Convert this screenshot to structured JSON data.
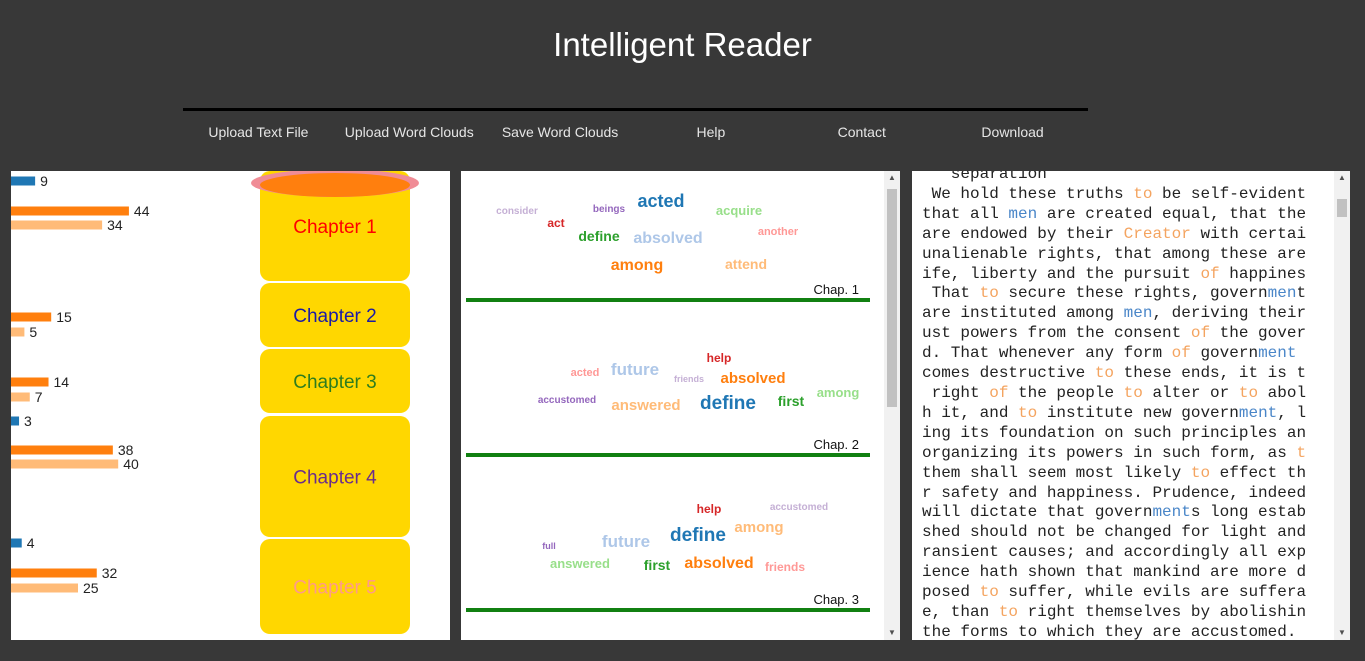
{
  "app": {
    "title": "Intelligent Reader"
  },
  "nav": [
    "Upload Text File",
    "Upload Word Clouds",
    "Save Word Clouds",
    "Help",
    "Contact",
    "Download"
  ],
  "colors": {
    "blue": "#1f77b4",
    "orange": "#ff7f0e",
    "light_orange": "#ffbb78",
    "chapter_fill": "#ffd700",
    "highlight": "#f08c96"
  },
  "chapters": [
    {
      "label": "Chapter 1",
      "color": "#ff0000"
    },
    {
      "label": "Chapter 2",
      "color": "#1a1aa6"
    },
    {
      "label": "Chapter 3",
      "color": "#2e7d1e"
    },
    {
      "label": "Chapter 4",
      "color": "#6a2c8c"
    },
    {
      "label": "Chapter 5",
      "color": "#ff9a8a"
    }
  ],
  "chart_data": {
    "type": "bar",
    "orientation": "horizontal",
    "groups": [
      {
        "chapter": "Chapter 1",
        "values": [
          {
            "series": "blue",
            "value": 9
          },
          {
            "series": "orange",
            "value": 44
          },
          {
            "series": "light_orange",
            "value": 34
          }
        ]
      },
      {
        "chapter": "Chapter 2",
        "values": [
          {
            "series": "orange",
            "value": 15
          },
          {
            "series": "light_orange",
            "value": 5
          }
        ]
      },
      {
        "chapter": "Chapter 3",
        "values": [
          {
            "series": "orange",
            "value": 14
          },
          {
            "series": "light_orange",
            "value": 7
          },
          {
            "series": "blue",
            "value": 3
          }
        ]
      },
      {
        "chapter": "Chapter 4",
        "values": [
          {
            "series": "orange",
            "value": 38
          },
          {
            "series": "light_orange",
            "value": 40
          }
        ]
      },
      {
        "chapter": "Chapter 5",
        "values": [
          {
            "series": "blue",
            "value": 4
          },
          {
            "series": "orange",
            "value": 32
          },
          {
            "series": "light_orange",
            "value": 25
          }
        ]
      }
    ]
  },
  "word_clouds": [
    {
      "label": "Chap. 1",
      "words": [
        {
          "text": "consider",
          "color": "#c5b0d5",
          "size": 10
        },
        {
          "text": "beings",
          "color": "#9467bd",
          "size": 10
        },
        {
          "text": "acted",
          "color": "#1f77b4",
          "size": 18
        },
        {
          "text": "acquire",
          "color": "#98df8a",
          "size": 13
        },
        {
          "text": "act",
          "color": "#d62728",
          "size": 12
        },
        {
          "text": "define",
          "color": "#2ca02c",
          "size": 14
        },
        {
          "text": "absolved",
          "color": "#aec7e8",
          "size": 16
        },
        {
          "text": "another",
          "color": "#ff9896",
          "size": 11
        },
        {
          "text": "among",
          "color": "#ff7f0e",
          "size": 16
        },
        {
          "text": "attend",
          "color": "#ffbb78",
          "size": 14
        }
      ]
    },
    {
      "label": "Chap. 2",
      "words": [
        {
          "text": "help",
          "color": "#d62728",
          "size": 12
        },
        {
          "text": "acted",
          "color": "#ff9896",
          "size": 11
        },
        {
          "text": "future",
          "color": "#aec7e8",
          "size": 17
        },
        {
          "text": "friends",
          "color": "#c5b0d5",
          "size": 9
        },
        {
          "text": "absolved",
          "color": "#ff7f0e",
          "size": 15
        },
        {
          "text": "among",
          "color": "#98df8a",
          "size": 13
        },
        {
          "text": "accustomed",
          "color": "#9467bd",
          "size": 10
        },
        {
          "text": "answered",
          "color": "#ffbb78",
          "size": 15
        },
        {
          "text": "define",
          "color": "#1f77b4",
          "size": 19
        },
        {
          "text": "first",
          "color": "#2ca02c",
          "size": 14
        }
      ]
    },
    {
      "label": "Chap. 3",
      "words": [
        {
          "text": "help",
          "color": "#d62728",
          "size": 12
        },
        {
          "text": "accustomed",
          "color": "#c5b0d5",
          "size": 10
        },
        {
          "text": "among",
          "color": "#ffbb78",
          "size": 15
        },
        {
          "text": "define",
          "color": "#1f77b4",
          "size": 19
        },
        {
          "text": "full",
          "color": "#9467bd",
          "size": 9
        },
        {
          "text": "future",
          "color": "#aec7e8",
          "size": 17
        },
        {
          "text": "answered",
          "color": "#98df8a",
          "size": 13
        },
        {
          "text": "first",
          "color": "#2ca02c",
          "size": 14
        },
        {
          "text": "absolved",
          "color": "#ff7f0e",
          "size": 16
        },
        {
          "text": "friends",
          "color": "#ff9896",
          "size": 12
        }
      ]
    }
  ],
  "reader": {
    "lines": [
      [
        {
          "t": "   separation"
        }
      ],
      [
        {
          "t": " We hold these truths "
        },
        {
          "t": "to",
          "c": "o"
        },
        {
          "t": " be self-evident"
        }
      ],
      [
        {
          "t": "that all "
        },
        {
          "t": "men",
          "c": "b"
        },
        {
          "t": " are created equal, that the"
        }
      ],
      [
        {
          "t": "are endowed by their "
        },
        {
          "t": "Creator",
          "c": "o"
        },
        {
          "t": " with certai"
        }
      ],
      [
        {
          "t": "unalienable rights, that among these are"
        }
      ],
      [
        {
          "t": "ife, liberty and the pursuit "
        },
        {
          "t": "of",
          "c": "o"
        },
        {
          "t": " happines"
        }
      ],
      [
        {
          "t": " That "
        },
        {
          "t": "to",
          "c": "o"
        },
        {
          "t": " secure these rights, govern"
        },
        {
          "t": "men",
          "c": "b"
        },
        {
          "t": "t"
        }
      ],
      [
        {
          "t": "are instituted among "
        },
        {
          "t": "men",
          "c": "b"
        },
        {
          "t": ", deriving their"
        }
      ],
      [
        {
          "t": "ust powers from the consent "
        },
        {
          "t": "of",
          "c": "o"
        },
        {
          "t": " the gover"
        }
      ],
      [
        {
          "t": "d. That whenever any form "
        },
        {
          "t": "of",
          "c": "o"
        },
        {
          "t": " govern"
        },
        {
          "t": "ment",
          "c": "b"
        }
      ],
      [
        {
          "t": "comes destructive "
        },
        {
          "t": "to",
          "c": "o"
        },
        {
          "t": " these ends, it is t"
        }
      ],
      [
        {
          "t": " right "
        },
        {
          "t": "of",
          "c": "o"
        },
        {
          "t": " the people "
        },
        {
          "t": "to",
          "c": "o"
        },
        {
          "t": " alter or "
        },
        {
          "t": "to",
          "c": "o"
        },
        {
          "t": " abol"
        }
      ],
      [
        {
          "t": "h it, and "
        },
        {
          "t": "to",
          "c": "o"
        },
        {
          "t": " institute new govern"
        },
        {
          "t": "ment",
          "c": "b"
        },
        {
          "t": ", l"
        }
      ],
      [
        {
          "t": "ing its foundation on such principles an"
        }
      ],
      [
        {
          "t": "organizing its powers in such form, as "
        },
        {
          "t": "t",
          "c": "o"
        }
      ],
      [
        {
          "t": "them shall seem most likely "
        },
        {
          "t": "to",
          "c": "o"
        },
        {
          "t": " effect th"
        }
      ],
      [
        {
          "t": "r safety and happiness. Prudence, indeed"
        }
      ],
      [
        {
          "t": "will dictate that govern"
        },
        {
          "t": "ment",
          "c": "b"
        },
        {
          "t": "s long estab"
        }
      ],
      [
        {
          "t": "shed should not be changed for light and"
        }
      ],
      [
        {
          "t": "ransient causes; and accordingly all exp"
        }
      ],
      [
        {
          "t": "ience hath shown that mankind are more d"
        }
      ],
      [
        {
          "t": "posed "
        },
        {
          "t": "to",
          "c": "o"
        },
        {
          "t": " suffer, while evils are sufferа"
        }
      ],
      [
        {
          "t": "e, than "
        },
        {
          "t": "to",
          "c": "o"
        },
        {
          "t": " right themselves by abolishin"
        }
      ],
      [
        {
          "t": "the forms to which they are accustomed."
        }
      ]
    ]
  }
}
